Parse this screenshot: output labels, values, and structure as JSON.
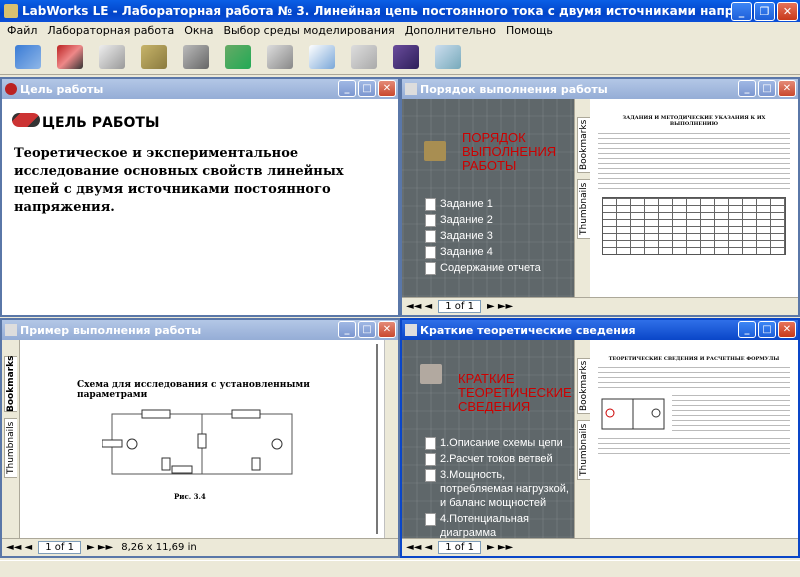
{
  "window": {
    "title": "LabWorks LE - Лабораторная работа № 3. Линейная цепь постоянного тока с двумя источниками напряжения"
  },
  "menu": [
    "Файл",
    "Лабораторная работа",
    "Окна",
    "Выбор среды моделирования",
    "Дополнительно",
    "Помощь"
  ],
  "toolbar": {
    "icons": [
      "students-icon",
      "pointer-icon",
      "book-icon",
      "folder-open-icon",
      "save-icon",
      "network-icon",
      "pointer-gray-icon",
      "notepad-icon",
      "pen-icon",
      "manual-icon",
      "calculator-icon"
    ]
  },
  "panel_goal": {
    "title": "Цель работы",
    "heading": "ЦЕЛЬ РАБОТЫ",
    "text": "Теоретическое и экспериментальное исследование основных свойств линейных цепей с двумя источниками постоянного напряжения."
  },
  "panel_order": {
    "title": "Порядок выполнения работы",
    "section_title": "ПОРЯДОК ВЫПОЛНЕНИЯ РАБОТЫ",
    "items": [
      "Задание 1",
      "Задание 2",
      "Задание 3",
      "Задание 4",
      "Содержание отчета"
    ],
    "tab_bookmarks": "Bookmarks",
    "tab_thumbnails": "Thumbnails",
    "page": "1 of 1"
  },
  "panel_example": {
    "title": "Пример выполнения работы",
    "scheme_title": "Схема для исследования с установленными параметрами",
    "figure_caption": "Рис. 3.4",
    "tab_bookmarks": "Bookmarks",
    "tab_thumbnails": "Thumbnails",
    "page": "1 of 1",
    "page_size": "8,26 x 11,69 in"
  },
  "panel_theory": {
    "title": "Краткие теоретические сведения",
    "section_title": "КРАТКИЕ ТЕОРЕТИЧЕСКИЕ СВЕДЕНИЯ",
    "items": [
      "1.Описание схемы цепи",
      "2.Расчет токов ветвей",
      "3.Мощность, потребляемая нагрузкой, и баланс мощностей",
      "4.Потенциальная диаграмма"
    ],
    "tab_bookmarks": "Bookmarks",
    "tab_thumbnails": "Thumbnails",
    "page": "1 of 1",
    "doc_heading": "ТЕОРЕТИЧЕСКИЕ СВЕДЕНИЯ И РАСЧЕТНЫЕ ФОРМУЛЫ"
  },
  "order_doc": {
    "heading": "ЗАДАНИЯ И МЕТОДИЧЕСКИЕ УКАЗАНИЯ К ИХ ВЫПОЛНЕНИЮ"
  },
  "colors": {
    "title_active": "#0a46c8",
    "title_inactive": "#95add6",
    "accent_red": "#cc0000",
    "pdf_bg": "#5f676a"
  }
}
